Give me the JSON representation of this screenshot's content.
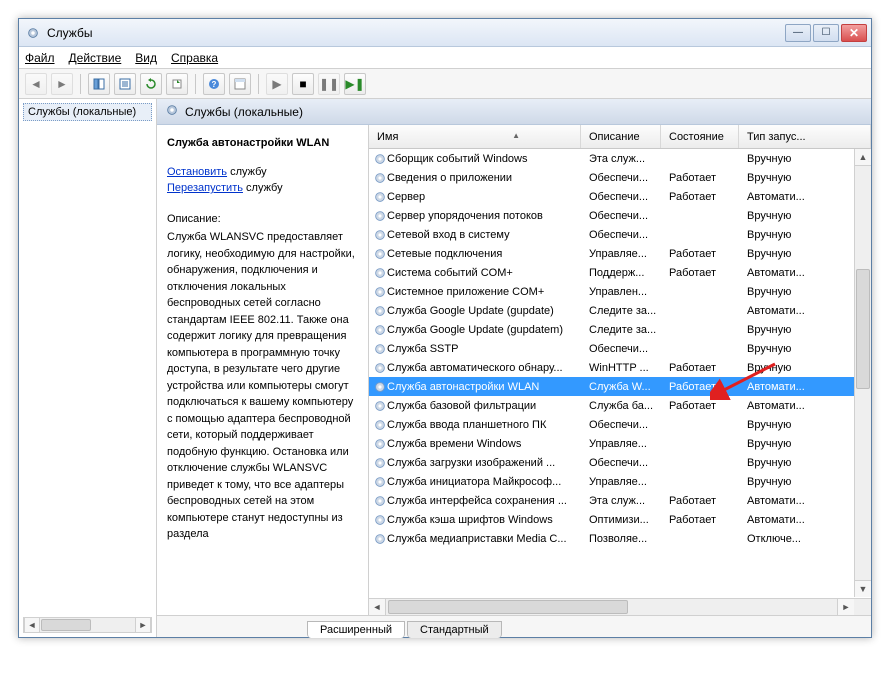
{
  "window": {
    "title": "Службы"
  },
  "menu": {
    "file": "Файл",
    "action": "Действие",
    "view": "Вид",
    "help": "Справка"
  },
  "tree": {
    "root": "Службы (локальные)"
  },
  "panel": {
    "heading": "Службы (локальные)"
  },
  "detail": {
    "serviceTitle": "Служба автонастройки WLAN",
    "stopLink": "Остановить",
    "stopSuffix": " службу",
    "restartLink": "Перезапустить",
    "restartSuffix": " службу",
    "descLabel": "Описание:",
    "descText": "Служба WLANSVC предоставляет логику, необходимую для настройки, обнаружения, подключения и отключения локальных беспроводных сетей согласно стандартам IEEE 802.11. Также она содержит логику для превращения компьютера в программную точку доступа, в результате чего другие устройства или компьютеры смогут подключаться к вашему компьютеру с помощью адаптера беспроводной сети, который поддерживает подобную функцию. Остановка или отключение службы WLANSVC приведет к тому, что все адаптеры беспроводных сетей на этом компьютере станут недоступны из раздела"
  },
  "columns": {
    "name": "Имя",
    "desc": "Описание",
    "state": "Состояние",
    "startup": "Тип запус..."
  },
  "tabs": {
    "extended": "Расширенный",
    "standard": "Стандартный"
  },
  "services": [
    {
      "name": "Сборщик событий Windows",
      "desc": "Эта служ...",
      "state": "",
      "startup": "Вручную"
    },
    {
      "name": "Сведения о приложении",
      "desc": "Обеспечи...",
      "state": "Работает",
      "startup": "Вручную"
    },
    {
      "name": "Сервер",
      "desc": "Обеспечи...",
      "state": "Работает",
      "startup": "Автомати..."
    },
    {
      "name": "Сервер упорядочения потоков",
      "desc": "Обеспечи...",
      "state": "",
      "startup": "Вручную"
    },
    {
      "name": "Сетевой вход в систему",
      "desc": "Обеспечи...",
      "state": "",
      "startup": "Вручную"
    },
    {
      "name": "Сетевые подключения",
      "desc": "Управляе...",
      "state": "Работает",
      "startup": "Вручную"
    },
    {
      "name": "Система событий COM+",
      "desc": "Поддерж...",
      "state": "Работает",
      "startup": "Автомати..."
    },
    {
      "name": "Системное приложение COM+",
      "desc": "Управлен...",
      "state": "",
      "startup": "Вручную"
    },
    {
      "name": "Служба Google Update (gupdate)",
      "desc": "Следите за...",
      "state": "",
      "startup": "Автомати..."
    },
    {
      "name": "Служба Google Update (gupdatem)",
      "desc": "Следите за...",
      "state": "",
      "startup": "Вручную"
    },
    {
      "name": "Служба SSTP",
      "desc": "Обеспечи...",
      "state": "",
      "startup": "Вручную"
    },
    {
      "name": "Служба автоматического обнару...",
      "desc": "WinHTTP ...",
      "state": "Работает",
      "startup": "Вручную"
    },
    {
      "name": "Служба автонастройки WLAN",
      "desc": "Служба W...",
      "state": "Работает",
      "startup": "Автомати...",
      "selected": true
    },
    {
      "name": "Служба базовой фильтрации",
      "desc": "Служба ба...",
      "state": "Работает",
      "startup": "Автомати..."
    },
    {
      "name": "Служба ввода планшетного ПК",
      "desc": "Обеспечи...",
      "state": "",
      "startup": "Вручную"
    },
    {
      "name": "Служба времени Windows",
      "desc": "Управляе...",
      "state": "",
      "startup": "Вручную"
    },
    {
      "name": "Служба загрузки изображений ...",
      "desc": "Обеспечи...",
      "state": "",
      "startup": "Вручную"
    },
    {
      "name": "Служба инициатора Майкрософ...",
      "desc": "Управляе...",
      "state": "",
      "startup": "Вручную"
    },
    {
      "name": "Служба интерфейса сохранения ...",
      "desc": "Эта служ...",
      "state": "Работает",
      "startup": "Автомати..."
    },
    {
      "name": "Служба кэша шрифтов Windows",
      "desc": "Оптимизи...",
      "state": "Работает",
      "startup": "Автомати..."
    },
    {
      "name": "Служба медиаприставки Media C...",
      "desc": "Позволяе...",
      "state": "",
      "startup": "Отключе..."
    }
  ]
}
